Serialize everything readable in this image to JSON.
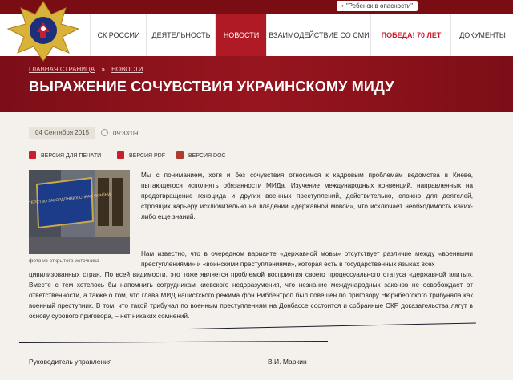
{
  "top": {
    "child_link": "\"Ребенок в опасности\""
  },
  "nav": [
    "СК РОССИИ",
    "ДЕЯТЕЛЬНОСТЬ",
    "НОВОСТИ",
    "ВЗАИМОДЕЙСТВИЕ СО СМИ",
    "ПОБЕДА! 70 ЛЕТ",
    "ДОКУМЕНТЫ"
  ],
  "breadcrumb": {
    "home": "ГЛАВНАЯ СТРАНИЦА",
    "separator": "»",
    "section": "НОВОСТИ"
  },
  "title": "ВЫРАЖЕНИЕ СОЧУВСТВИЯ УКРАИНСКОМУ МИДУ",
  "meta": {
    "date": "04 Сентября 2015",
    "time": "09:33:09"
  },
  "versions": {
    "print": "ВЕРСИЯ ДЛЯ ПЕЧАТИ",
    "pdf": "ВЕРСИЯ PDF",
    "doc": "ВЕРСИЯ DOC"
  },
  "photo": {
    "caption": "фото из открытого источника",
    "sign_text": "МІНІСТЕРСТВО ЗАКОРДОННИХ СПРАВ УКРАЇНИ"
  },
  "article": {
    "p1": "Мы с пониманием, хотя и без сочувствия относимся к кадровым проблемам ведомства в Киеве, пытающегося исполнять обязанности МИДа. Изучение международных конвенций, направленных на предотвращение геноцида и других военных преступлений, действительно, сложно для деятелей, строящих карьеру исключительно на владении «державной мовой», что исключает необходимость каких-либо еще знаний.",
    "p2a": "Нам известно, что в очередном варианте «державной мовы» отсутствует различие между «военными преступлениями» и «воинскими преступлениями», которая есть в государственных языках всех",
    "p2b": "цивилизованных стран. По всей видимости, это тоже является проблемой восприятия своего процессуального статуса «державной элиты». Вместе с тем хотелось бы напомнить сотрудникам киевского недоразумения, что незнание международных законов не освобождает от ответственности, а также о том, что глава МИД нацистского режима фон Риббентроп был повешен по приговору Нюрнбергского трибунала как военный преступник. В том, что такой трибунал по военным преступлениям на Донбассе состоится и собранные СКР доказательства лягут в основу сурового приговора, – нет никаких сомнений."
  },
  "footer": {
    "position": "Руководитель управления",
    "name": "В.И. Маркин"
  },
  "colors": {
    "brand": "#b01a24",
    "banner": "#8c111c",
    "background": "#f4f1ec"
  }
}
